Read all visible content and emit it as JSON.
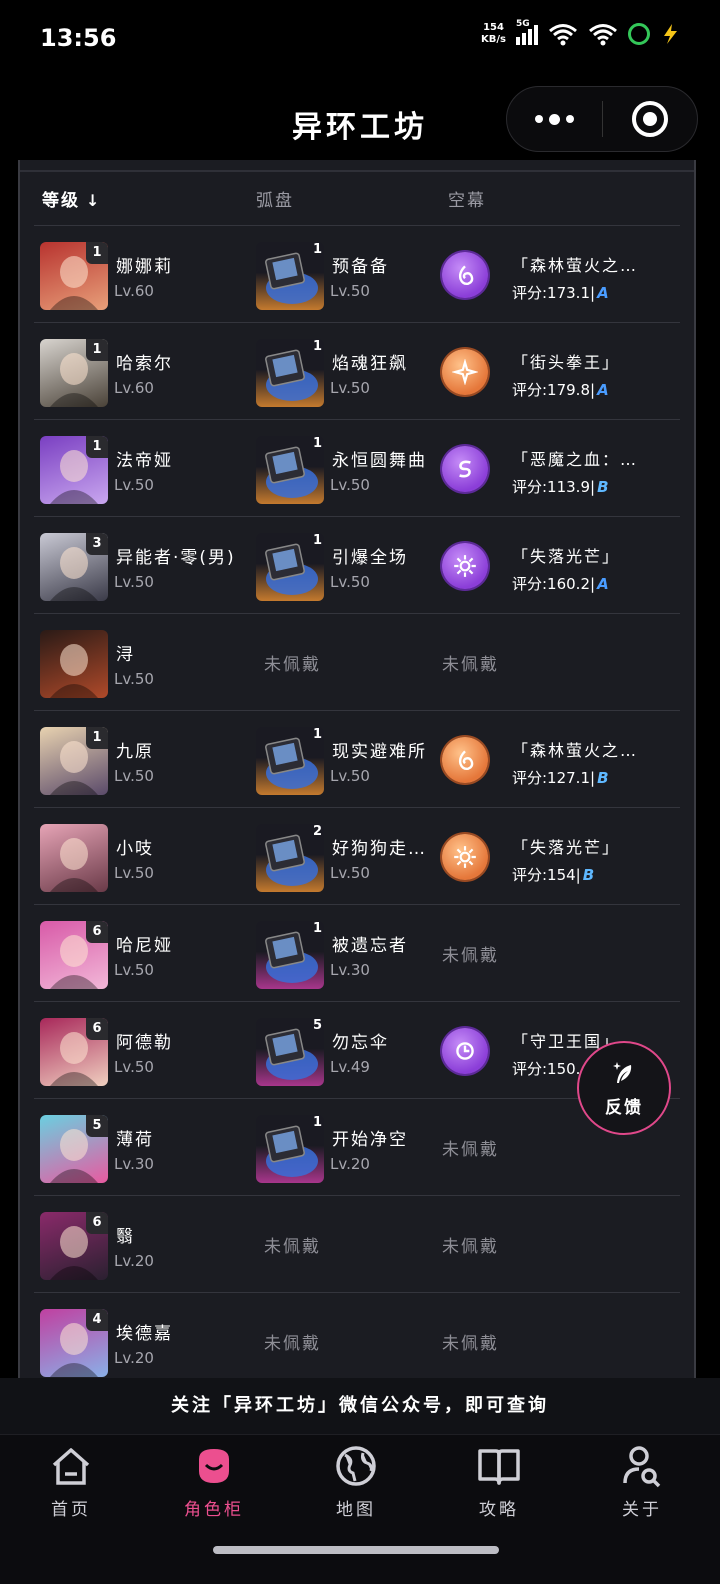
{
  "status_bar": {
    "time": "13:56",
    "net_speed_value": "154",
    "net_speed_unit": "KB/s",
    "signal_label": "5G",
    "icons": [
      "signal-icon",
      "wifi-icon",
      "wifi-icon",
      "ring-icon",
      "bolt-icon"
    ]
  },
  "header": {
    "title": "异环工坊",
    "capsule_icons": [
      "more-dots-icon",
      "target-icon"
    ]
  },
  "table": {
    "columns": {
      "level": "等级",
      "level_arrow": "↓",
      "disk": "弧盘",
      "curtain": "空幕"
    },
    "rows": [
      {
        "name": "娜娜莉",
        "level": "Lv.60",
        "rank": "1",
        "avatar_colors": [
          "#b8332f",
          "#e8a07a"
        ],
        "disk": {
          "name": "预备备",
          "level": "Lv.50",
          "rank": "1",
          "bg": "#c47a2e"
        },
        "curtain": {
          "icon": "flame-spiral-icon",
          "tone": "purple",
          "name": "「森林萤火之…",
          "score_label": "评分:173.1|",
          "grade": "A"
        }
      },
      {
        "name": "哈索尔",
        "level": "Lv.60",
        "rank": "1",
        "avatar_colors": [
          "#d8d4cf",
          "#4a4238"
        ],
        "disk": {
          "name": "焰魂狂飙",
          "level": "Lv.50",
          "rank": "1",
          "bg": "#c47a2e"
        },
        "curtain": {
          "icon": "shuriken-icon",
          "tone": "orange",
          "name": "「街头拳王」",
          "score_label": "评分:179.8|",
          "grade": "A"
        }
      },
      {
        "name": "法帝娅",
        "level": "Lv.50",
        "rank": "1",
        "avatar_colors": [
          "#7a3fc2",
          "#c9a7ef"
        ],
        "disk": {
          "name": "永恒圆舞曲",
          "level": "Lv.50",
          "rank": "1",
          "bg": "#c47a2e"
        },
        "curtain": {
          "icon": "s-swirl-icon",
          "tone": "purple",
          "name": "「恶魔之血：…",
          "score_label": "评分:113.9|",
          "grade": "B"
        }
      },
      {
        "name": "异能者·零(男)",
        "level": "Lv.50",
        "rank": "3",
        "avatar_colors": [
          "#c9c9d4",
          "#3a3a48"
        ],
        "disk": {
          "name": "引爆全场",
          "level": "Lv.50",
          "rank": "1",
          "bg": "#c47a2e"
        },
        "curtain": {
          "icon": "sun-icon",
          "tone": "purple",
          "name": "「失落光芒」",
          "score_label": "评分:160.2|",
          "grade": "A"
        }
      },
      {
        "name": "浔",
        "level": "Lv.50",
        "rank": "",
        "avatar_colors": [
          "#2a1a16",
          "#b04a2a"
        ],
        "disk": null,
        "curtain": null,
        "empty_label": "未佩戴"
      },
      {
        "name": "九原",
        "level": "Lv.50",
        "rank": "1",
        "avatar_colors": [
          "#e8d2b0",
          "#5a4a6a"
        ],
        "disk": {
          "name": "现实避难所",
          "level": "Lv.50",
          "rank": "1",
          "bg": "#c47a2e"
        },
        "curtain": {
          "icon": "flame-spiral-icon",
          "tone": "orange",
          "name": "「森林萤火之…",
          "score_label": "评分:127.1|",
          "grade": "B"
        }
      },
      {
        "name": "小吱",
        "level": "Lv.50",
        "rank": "",
        "avatar_colors": [
          "#e6a4b6",
          "#6a3a48"
        ],
        "disk": {
          "name": "好狗狗走…",
          "level": "Lv.50",
          "rank": "2",
          "bg": "#c47a2e"
        },
        "curtain": {
          "icon": "sun-icon",
          "tone": "orange",
          "name": "「失落光芒」",
          "score_label": "评分:154|",
          "grade": "B"
        }
      },
      {
        "name": "哈尼娅",
        "level": "Lv.50",
        "rank": "6",
        "avatar_colors": [
          "#d85aa8",
          "#f2b8d8"
        ],
        "disk": {
          "name": "被遗忘者",
          "level": "Lv.30",
          "rank": "1",
          "bg": "#a8368c"
        },
        "curtain": null,
        "empty_label": "未佩戴"
      },
      {
        "name": "阿德勒",
        "level": "Lv.50",
        "rank": "6",
        "avatar_colors": [
          "#a8285a",
          "#f0d0c0"
        ],
        "disk": {
          "name": "勿忘伞",
          "level": "Lv.49",
          "rank": "5",
          "bg": "#a8368c"
        },
        "curtain": {
          "icon": "clock-swirl-icon",
          "tone": "purple",
          "name": "「守卫王国」",
          "score_label": "评分:150.",
          "grade": ""
        }
      },
      {
        "name": "薄荷",
        "level": "Lv.30",
        "rank": "5",
        "avatar_colors": [
          "#6acfe0",
          "#e85aa0"
        ],
        "disk": {
          "name": "开始净空",
          "level": "Lv.20",
          "rank": "1",
          "bg": "#a8368c"
        },
        "curtain": null,
        "empty_label": "未佩戴"
      },
      {
        "name": "翳",
        "level": "Lv.20",
        "rank": "6",
        "avatar_colors": [
          "#8a2a6a",
          "#2a2030"
        ],
        "disk": null,
        "curtain": null,
        "empty_label": "未佩戴"
      },
      {
        "name": "埃德嘉",
        "level": "Lv.20",
        "rank": "4",
        "avatar_colors": [
          "#c040a0",
          "#8ab0e8"
        ],
        "disk": null,
        "curtain": null,
        "empty_label": "未佩戴"
      }
    ]
  },
  "feedback": {
    "label": "反馈",
    "icon": "quill-sparkle-icon"
  },
  "notice": "关注「异环工坊」微信公众号，即可查询",
  "tabs": [
    {
      "label": "首页",
      "icon": "home-icon",
      "active": false
    },
    {
      "label": "角色柜",
      "icon": "character-icon",
      "active": true
    },
    {
      "label": "地图",
      "icon": "globe-icon",
      "active": false
    },
    {
      "label": "攻略",
      "icon": "book-icon",
      "active": false
    },
    {
      "label": "关于",
      "icon": "user-search-icon",
      "active": false
    }
  ],
  "colors": {
    "accent": "#ec4f8f",
    "panel": "#1b1c22",
    "grade": "#4a9cff"
  }
}
